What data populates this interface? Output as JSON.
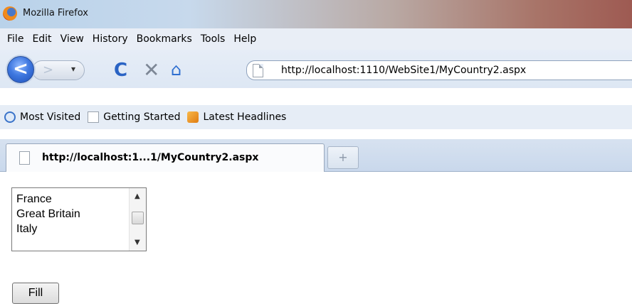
{
  "window": {
    "title": "Mozilla Firefox"
  },
  "menu": {
    "items": [
      {
        "label": "File"
      },
      {
        "label": "Edit"
      },
      {
        "label": "View"
      },
      {
        "label": "History"
      },
      {
        "label": "Bookmarks"
      },
      {
        "label": "Tools"
      },
      {
        "label": "Help"
      }
    ]
  },
  "nav": {
    "url": "http://localhost:1110/WebSite1/MyCountry2.aspx",
    "reload_glyph": "C",
    "stop_glyph": "✕",
    "home_glyph": "⌂"
  },
  "bookmarks": {
    "items": [
      {
        "label": "Most Visited",
        "icon": "search-icon"
      },
      {
        "label": "Getting Started",
        "icon": "page-icon"
      },
      {
        "label": "Latest Headlines",
        "icon": "rss-icon"
      }
    ]
  },
  "tabs": {
    "active_title": "http://localhost:1...1/MyCountry2.aspx",
    "new_tab_glyph": "+"
  },
  "page": {
    "listbox": {
      "options": [
        "France",
        "Great Britain",
        "Italy"
      ]
    },
    "fill_button_label": "Fill"
  }
}
